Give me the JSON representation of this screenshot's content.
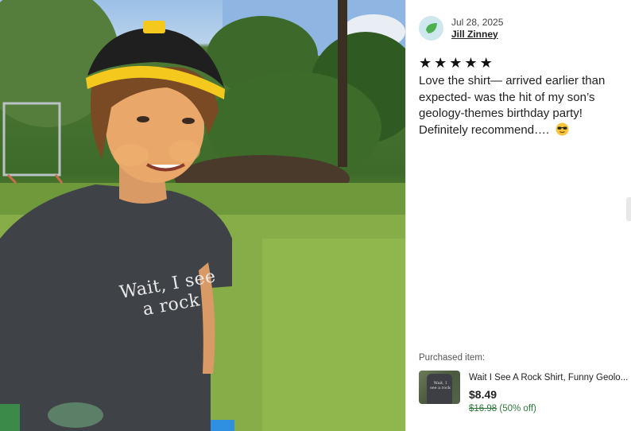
{
  "review": {
    "date": "Jul 28, 2025",
    "reviewer_name": "Jill Zinney",
    "rating": 5,
    "rating_max": 5,
    "star_glyph": "★",
    "text": "Love the shirt— arrived earlier than expected- was the hit of my son’s geology-themes birthday party! Definitely recommend…. ",
    "text_emoji": "smiling-face-with-sunglasses",
    "photo_shirt_text": [
      "Wait, I see",
      "a rock"
    ]
  },
  "purchased": {
    "label": "Purchased item:",
    "title": "Wait I See A Rock Shirt, Funny Geolo...",
    "price": "$8.49",
    "original_price": "$16.98",
    "discount": "(50% off)",
    "thumb_text": "Wait, I see a rock"
  },
  "colors": {
    "accent_green": "#2c7a3a",
    "avatar_bg": "#cfe7ef",
    "avatar_leaf": "#4caf50"
  }
}
